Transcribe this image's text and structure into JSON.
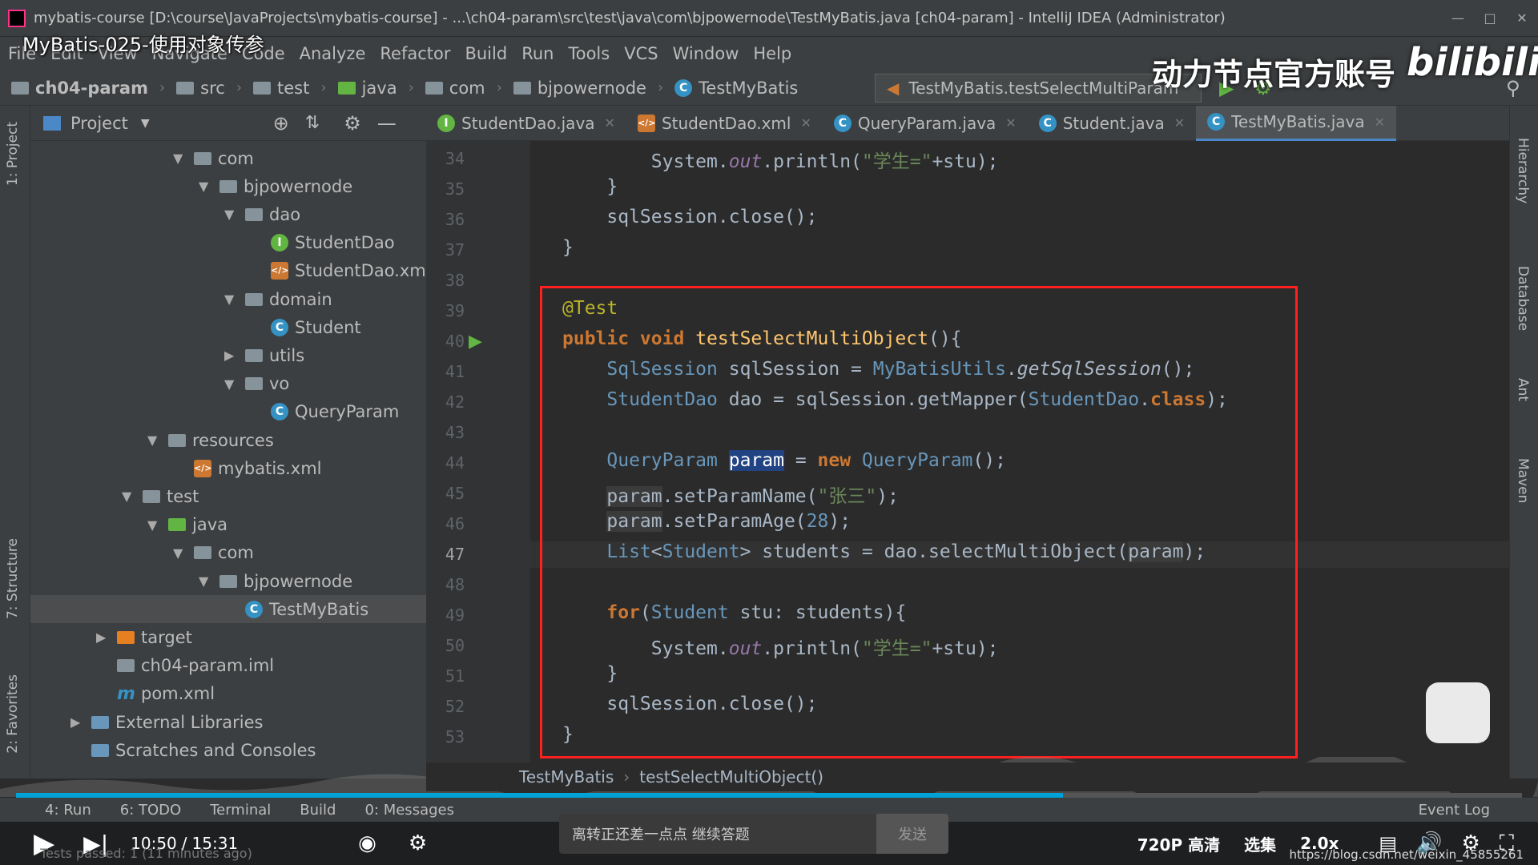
{
  "window": {
    "title": "mybatis-course [D:\\course\\JavaProjects\\mybatis-course] - ...\\ch04-param\\src\\test\\java\\com\\bjpowernode\\TestMyBatis.java [ch04-param] - IntelliJ IDEA (Administrator)"
  },
  "video": {
    "title": "MyBatis-025-使用对象传参",
    "watermark": "动力节点官方账号",
    "brand": "bilibili",
    "time_current": "10:50",
    "time_sep": "/",
    "time_total": "15:31",
    "quality": "720P 高清",
    "episodes": "选集",
    "speed": "2.0x",
    "danmu_placeholder": "离转正还差一点点 继续答题",
    "danmu_send": "发送",
    "progress_fraction": 0.695,
    "bottom_url": "https://blog.csdn.net/weixin_45855261"
  },
  "menu": [
    "File",
    "Edit",
    "View",
    "Navigate",
    "Code",
    "Analyze",
    "Refactor",
    "Build",
    "Run",
    "Tools",
    "VCS",
    "Window",
    "Help"
  ],
  "nav": {
    "crumbs": [
      "ch04-param",
      "src",
      "test",
      "java",
      "com",
      "bjpowernode",
      "TestMyBatis"
    ],
    "run_config": "TestMyBatis.testSelectMultiParam"
  },
  "project": {
    "header": "Project",
    "tree": [
      {
        "label": "com",
        "indent": 3,
        "arrow": "down",
        "icon": "folder"
      },
      {
        "label": "bjpowernode",
        "indent": 4,
        "arrow": "down",
        "icon": "folder"
      },
      {
        "label": "dao",
        "indent": 5,
        "arrow": "down",
        "icon": "folder"
      },
      {
        "label": "StudentDao",
        "indent": 6,
        "arrow": "",
        "icon": "interface"
      },
      {
        "label": "StudentDao.xml",
        "indent": 6,
        "arrow": "",
        "icon": "xml"
      },
      {
        "label": "domain",
        "indent": 5,
        "arrow": "down",
        "icon": "folder"
      },
      {
        "label": "Student",
        "indent": 6,
        "arrow": "",
        "icon": "class"
      },
      {
        "label": "utils",
        "indent": 5,
        "arrow": "right",
        "icon": "folder"
      },
      {
        "label": "vo",
        "indent": 5,
        "arrow": "down",
        "icon": "folder"
      },
      {
        "label": "QueryParam",
        "indent": 6,
        "arrow": "",
        "icon": "class"
      },
      {
        "label": "resources",
        "indent": 2,
        "arrow": "down",
        "icon": "folder"
      },
      {
        "label": "mybatis.xml",
        "indent": 3,
        "arrow": "",
        "icon": "xml"
      },
      {
        "label": "test",
        "indent": 1,
        "arrow": "down",
        "icon": "folder"
      },
      {
        "label": "java",
        "indent": 2,
        "arrow": "down",
        "icon": "folder-green"
      },
      {
        "label": "com",
        "indent": 3,
        "arrow": "down",
        "icon": "folder"
      },
      {
        "label": "bjpowernode",
        "indent": 4,
        "arrow": "down",
        "icon": "folder"
      },
      {
        "label": "TestMyBatis",
        "indent": 5,
        "arrow": "",
        "icon": "class",
        "selected": true
      },
      {
        "label": "target",
        "indent": 0,
        "arrow": "right",
        "icon": "folder-orange"
      },
      {
        "label": "ch04-param.iml",
        "indent": 0,
        "arrow": "",
        "icon": "iml"
      },
      {
        "label": "pom.xml",
        "indent": 0,
        "arrow": "",
        "icon": "maven"
      },
      {
        "label": "External Libraries",
        "indent": -1,
        "arrow": "right",
        "icon": "libs"
      },
      {
        "label": "Scratches and Consoles",
        "indent": -1,
        "arrow": "",
        "icon": "scratch"
      }
    ]
  },
  "tabs": [
    {
      "label": "StudentDao.java",
      "icon": "interface"
    },
    {
      "label": "StudentDao.xml",
      "icon": "xml"
    },
    {
      "label": "QueryParam.java",
      "icon": "class"
    },
    {
      "label": "Student.java",
      "icon": "class"
    },
    {
      "label": "TestMyBatis.java",
      "icon": "class",
      "active": true
    }
  ],
  "editor": {
    "line_numbers": [
      "34",
      "35",
      "36",
      "37",
      "38",
      "39",
      "40",
      "41",
      "42",
      "43",
      "44",
      "45",
      "46",
      "47",
      "48",
      "49",
      "50",
      "51",
      "52",
      "53"
    ],
    "current_line": "47"
  },
  "breadcrumb": [
    "TestMyBatis",
    "testSelectMultiObject()"
  ],
  "side_tabs_left": [
    "1: Project",
    "7: Structure",
    "2: Favorites"
  ],
  "side_tabs_right": [
    "Hierarchy",
    "Database",
    "Ant",
    "Maven"
  ],
  "bottom_tools": [
    "4: Run",
    "6: TODO",
    "Terminal",
    "Build",
    "0: Messages",
    "Event Log"
  ],
  "status": {
    "text": "Tests passed: 1 (11 minutes ago)"
  }
}
